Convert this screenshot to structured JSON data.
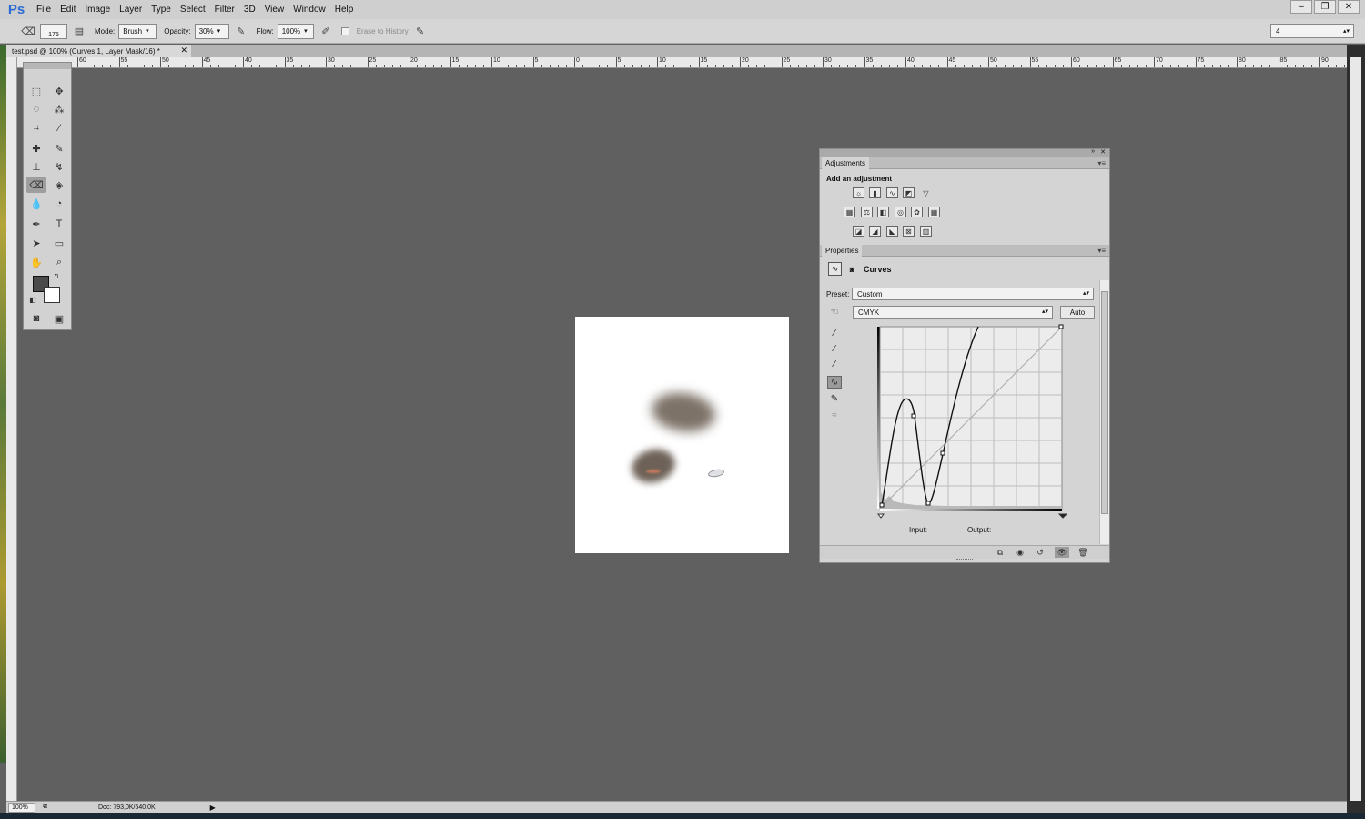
{
  "app": {
    "logo": "Ps"
  },
  "menu": [
    "File",
    "Edit",
    "Image",
    "Layer",
    "Type",
    "Select",
    "Filter",
    "3D",
    "View",
    "Window",
    "Help"
  ],
  "window_controls": {
    "minimize": "–",
    "restore": "❐",
    "close": "✕"
  },
  "options": {
    "brush_size": "175",
    "mode_label": "Mode:",
    "mode_value": "Brush",
    "opacity_label": "Opacity:",
    "opacity_value": "30%",
    "flow_label": "Flow:",
    "flow_value": "100%",
    "erase_history_label": "Erase to History",
    "workspace_value": "4"
  },
  "document": {
    "tab_title": "test.psd @ 100% (Curves 1, Layer Mask/16) *"
  },
  "ruler": {
    "labels": [
      "60",
      "55",
      "50",
      "45",
      "40",
      "35",
      "30",
      "25",
      "20",
      "15",
      "10",
      "5",
      "0",
      "5",
      "10",
      "15",
      "20",
      "25",
      "30",
      "35",
      "40",
      "45",
      "50",
      "55",
      "60",
      "65",
      "70",
      "75",
      "80",
      "85",
      "90"
    ]
  },
  "status": {
    "zoom": "100%",
    "doc_size": "Doc: 793,0K/640,0K"
  },
  "adjustments": {
    "tab": "Adjustments",
    "heading": "Add an adjustment"
  },
  "properties": {
    "tab": "Properties",
    "title": "Curves",
    "preset_label": "Preset:",
    "preset_value": "Custom",
    "channel_value": "CMYK",
    "auto_label": "Auto",
    "input_label": "Input:",
    "output_label": "Output:"
  },
  "colors": {
    "foreground": "#4a4a4a",
    "background": "#ffffff",
    "canvas_bg": "#606060"
  }
}
